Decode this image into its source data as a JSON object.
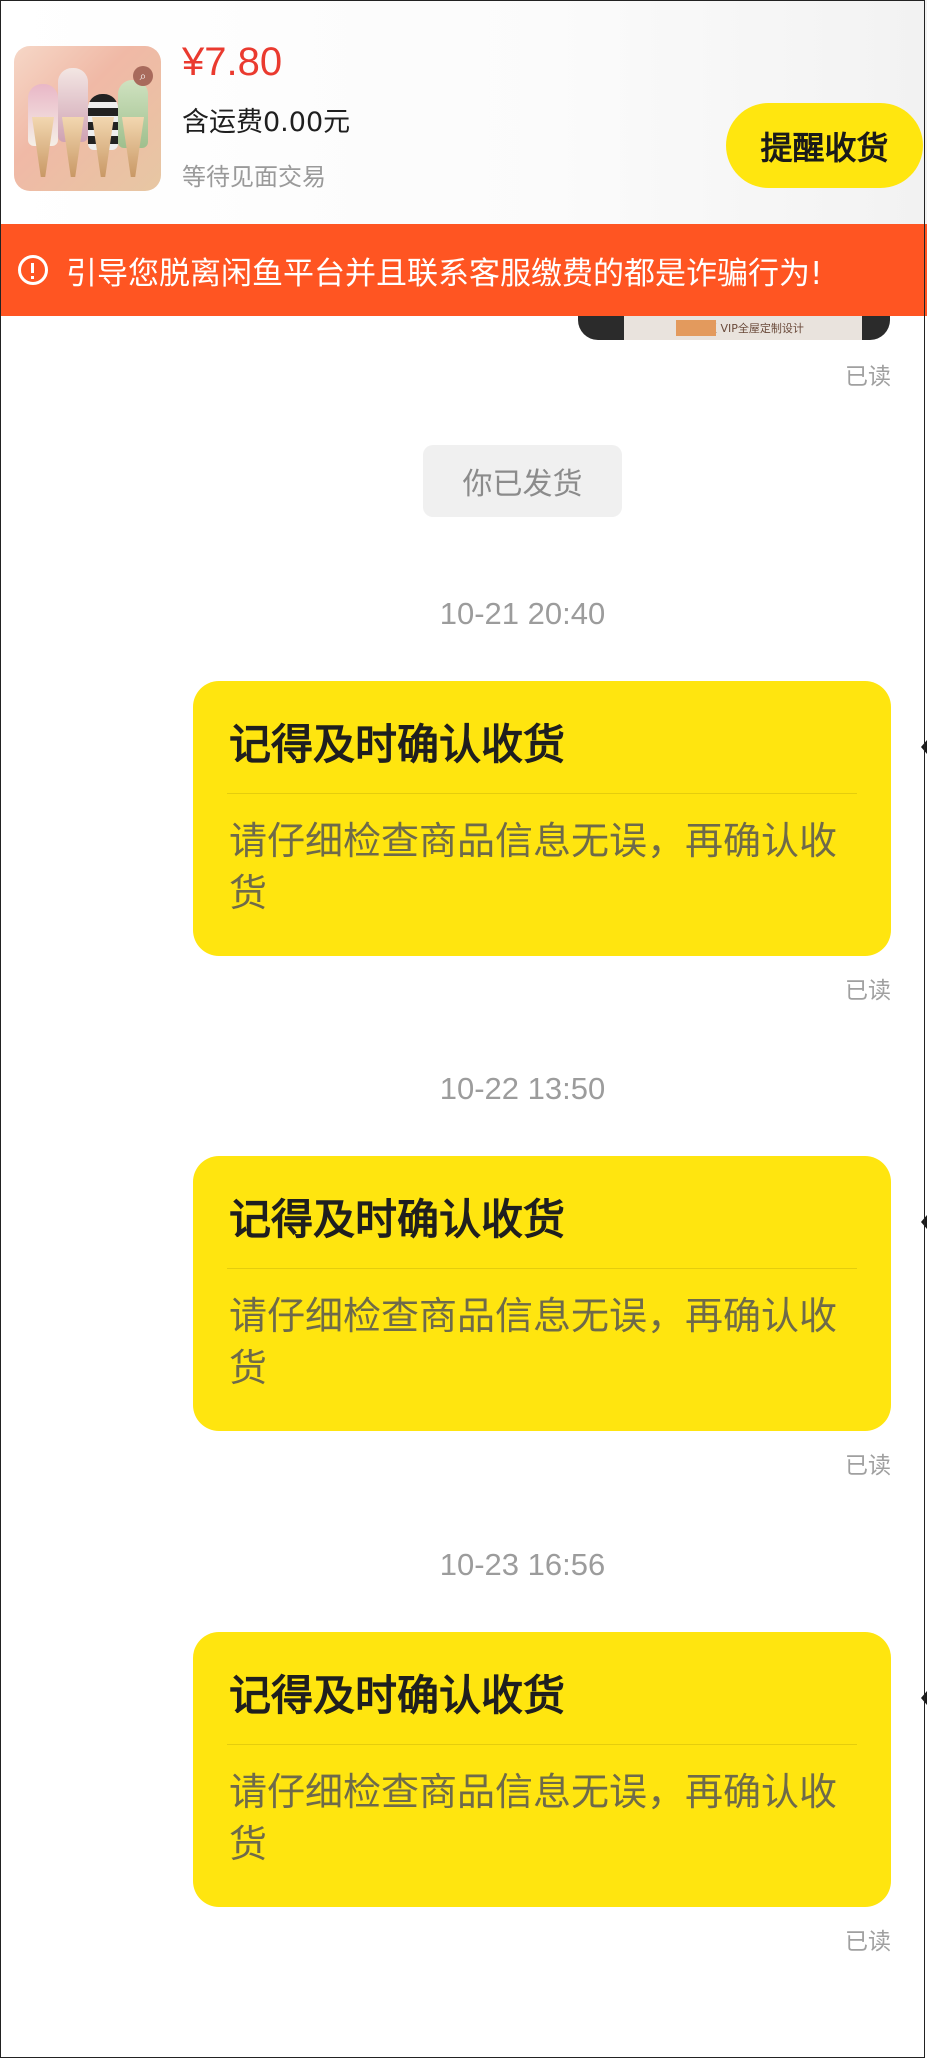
{
  "header": {
    "price": "¥7.80",
    "shipping": "含运费0.00元",
    "status": "等待见面交易",
    "remind_button": "提醒收货"
  },
  "warning": {
    "text": "引导您脱离闲鱼平台并且联系客服缴费的都是诈骗行为!"
  },
  "partial_image": {
    "caption": "素质豆 VIP全屋定制设计"
  },
  "system_message": "你已发货",
  "read_label": "已读",
  "messages": [
    {
      "timestamp": "10-21 20:40",
      "title": "记得及时确认收货",
      "body": "请仔细检查商品信息无误，再确认收货"
    },
    {
      "timestamp": "10-22 13:50",
      "title": "记得及时确认收货",
      "body": "请仔细检查商品信息无误，再确认收货"
    },
    {
      "timestamp": "10-23 16:56",
      "title": "记得及时确认收货",
      "body": "请仔细检查商品信息无误，再确认收货"
    }
  ],
  "colors": {
    "accent_yellow": "#ffe50f",
    "warning_red": "#ff5522",
    "price_red": "#ea3a2f"
  }
}
